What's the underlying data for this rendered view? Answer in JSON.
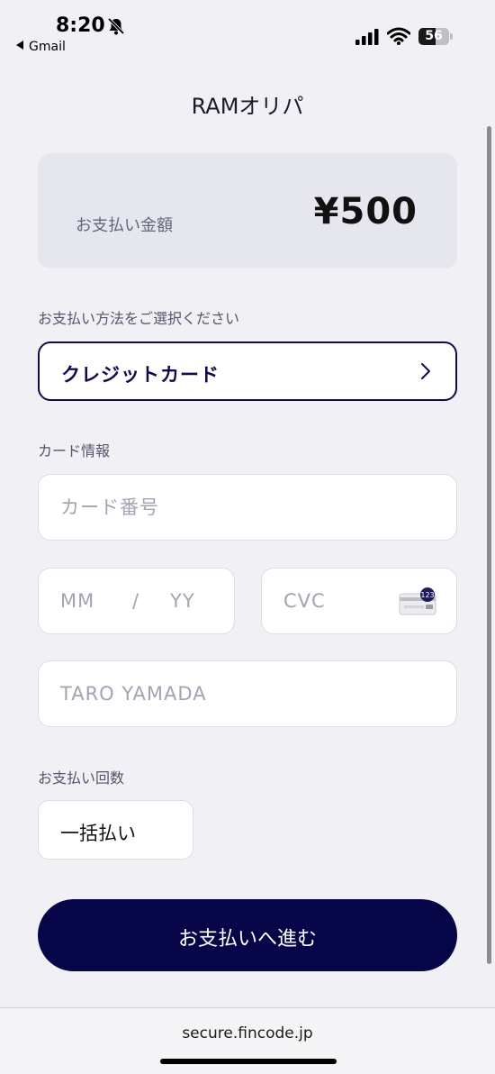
{
  "status_bar": {
    "time": "8:20",
    "back_app": "Gmail",
    "battery": "56",
    "battery_level": 0.56
  },
  "page": {
    "title": "RAMオリパ"
  },
  "amount": {
    "label": "お支払い金額",
    "value": "¥500"
  },
  "payment_method": {
    "label": "お支払い方法をご選択ください",
    "selected": "クレジットカード"
  },
  "card_info": {
    "label": "カード情報",
    "number_placeholder": "カード番号",
    "month_placeholder": "MM",
    "separator": "/",
    "year_placeholder": "YY",
    "cvc_placeholder": "CVC",
    "cvc_badge": "123",
    "name_placeholder": "TARO YAMADA"
  },
  "installments": {
    "label": "お支払い回数",
    "selected": "一括払い"
  },
  "submit": {
    "label": "お支払いへ進む"
  },
  "footer": {
    "domain": "secure.fincode.jp"
  },
  "colors": {
    "accent": "#050548",
    "background": "#f1f0f5"
  }
}
